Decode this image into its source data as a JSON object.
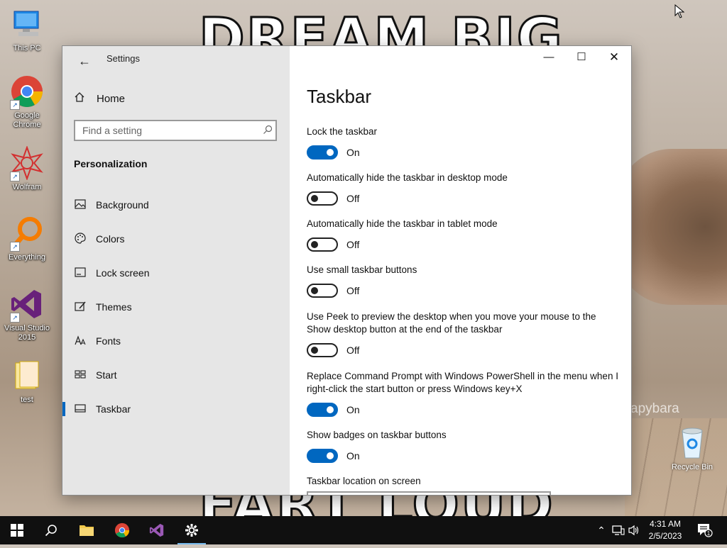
{
  "wallpaper": {
    "top_text": "DREAM BIG",
    "bottom_text": "FART LOUD",
    "watermark": "apybara"
  },
  "desktop_icons": [
    {
      "name": "this-pc",
      "label": "This PC"
    },
    {
      "name": "google-chrome",
      "label": "Google Chrome"
    },
    {
      "name": "wolfram",
      "label": "Wolfram"
    },
    {
      "name": "everything",
      "label": "Everything"
    },
    {
      "name": "visual-studio",
      "label": "Visual Studio 2015"
    },
    {
      "name": "test-folder",
      "label": "test"
    }
  ],
  "recycle_bin": {
    "label": "Recycle Bin"
  },
  "window": {
    "title": "Settings",
    "controls": {
      "minimize": "—",
      "maximize": "☐",
      "close": "✕"
    }
  },
  "sidebar": {
    "back_glyph": "←",
    "home_label": "Home",
    "search_placeholder": "Find a setting",
    "section_title": "Personalization",
    "items": [
      {
        "label": "Background",
        "icon": "image-icon"
      },
      {
        "label": "Colors",
        "icon": "palette-icon"
      },
      {
        "label": "Lock screen",
        "icon": "lock-screen-icon"
      },
      {
        "label": "Themes",
        "icon": "themes-icon"
      },
      {
        "label": "Fonts",
        "icon": "fonts-icon"
      },
      {
        "label": "Start",
        "icon": "start-icon"
      },
      {
        "label": "Taskbar",
        "icon": "taskbar-icon",
        "active": true
      }
    ]
  },
  "main": {
    "page_title": "Taskbar",
    "settings": [
      {
        "label": "Lock the taskbar",
        "state": "On"
      },
      {
        "label": "Automatically hide the taskbar in desktop mode",
        "state": "Off"
      },
      {
        "label": "Automatically hide the taskbar in tablet mode",
        "state": "Off"
      },
      {
        "label": "Use small taskbar buttons",
        "state": "Off"
      },
      {
        "label": "Use Peek to preview the desktop when you move your mouse to the Show desktop button at the end of the taskbar",
        "state": "Off"
      },
      {
        "label": "Replace Command Prompt with Windows PowerShell in the menu when I right-click the start button or press Windows key+X",
        "state": "On"
      },
      {
        "label": "Show badges on taskbar buttons",
        "state": "On"
      }
    ],
    "location_label": "Taskbar location on screen"
  },
  "taskbar": {
    "time": "4:31 AM",
    "date": "2/5/2023",
    "notification_count": "1"
  },
  "colors": {
    "accent": "#0067c0",
    "sidebar_bg": "#e6e6e6",
    "taskbar_bg": "#101010"
  }
}
